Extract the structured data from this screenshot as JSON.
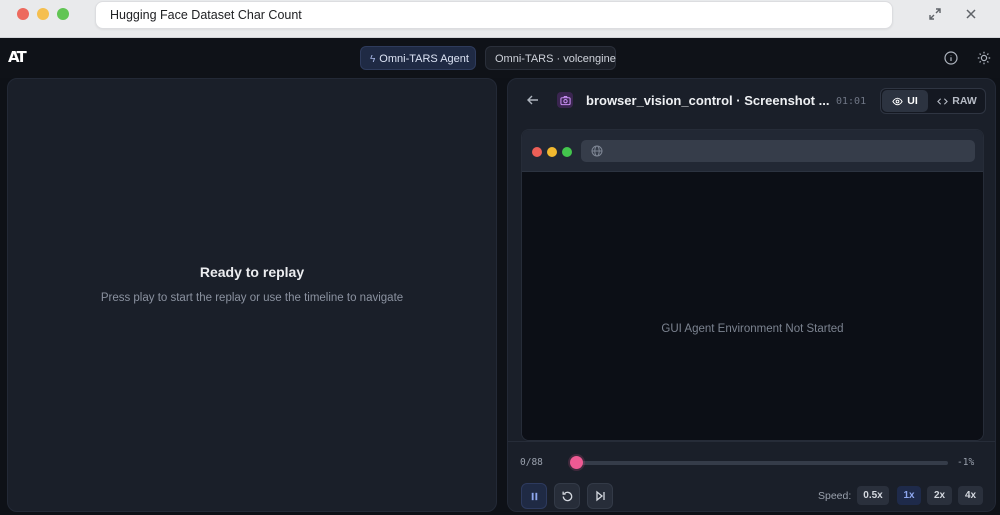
{
  "window": {
    "title": "Hugging Face Dataset Char Count"
  },
  "header": {
    "logo": "AT",
    "agent_chip": "Omni-TARS Agent",
    "model_chip": "Omni-TARS · volcengine"
  },
  "left_panel": {
    "title": "Ready to replay",
    "subtitle": "Press play to start the replay or use the timeline to navigate"
  },
  "right_panel": {
    "tool_title": "browser_vision_control · Screenshot ...",
    "time": "01:01",
    "view_ui_label": "UI",
    "view_raw_label": "RAW",
    "viewport_message": "GUI Agent Environment Not Started"
  },
  "replay": {
    "step_counter": "0/88",
    "progress_label": "-1%",
    "progress_fraction": 0.0,
    "speed_label": "Speed:",
    "speeds": [
      "0.5x",
      "1x",
      "2x",
      "4x"
    ],
    "selected_speed": "1x"
  },
  "colors": {
    "accent_pink": "#ee5a93",
    "accent_blue": "#8ea7ef",
    "background": "#0e1117",
    "panel": "#1a1f29"
  }
}
